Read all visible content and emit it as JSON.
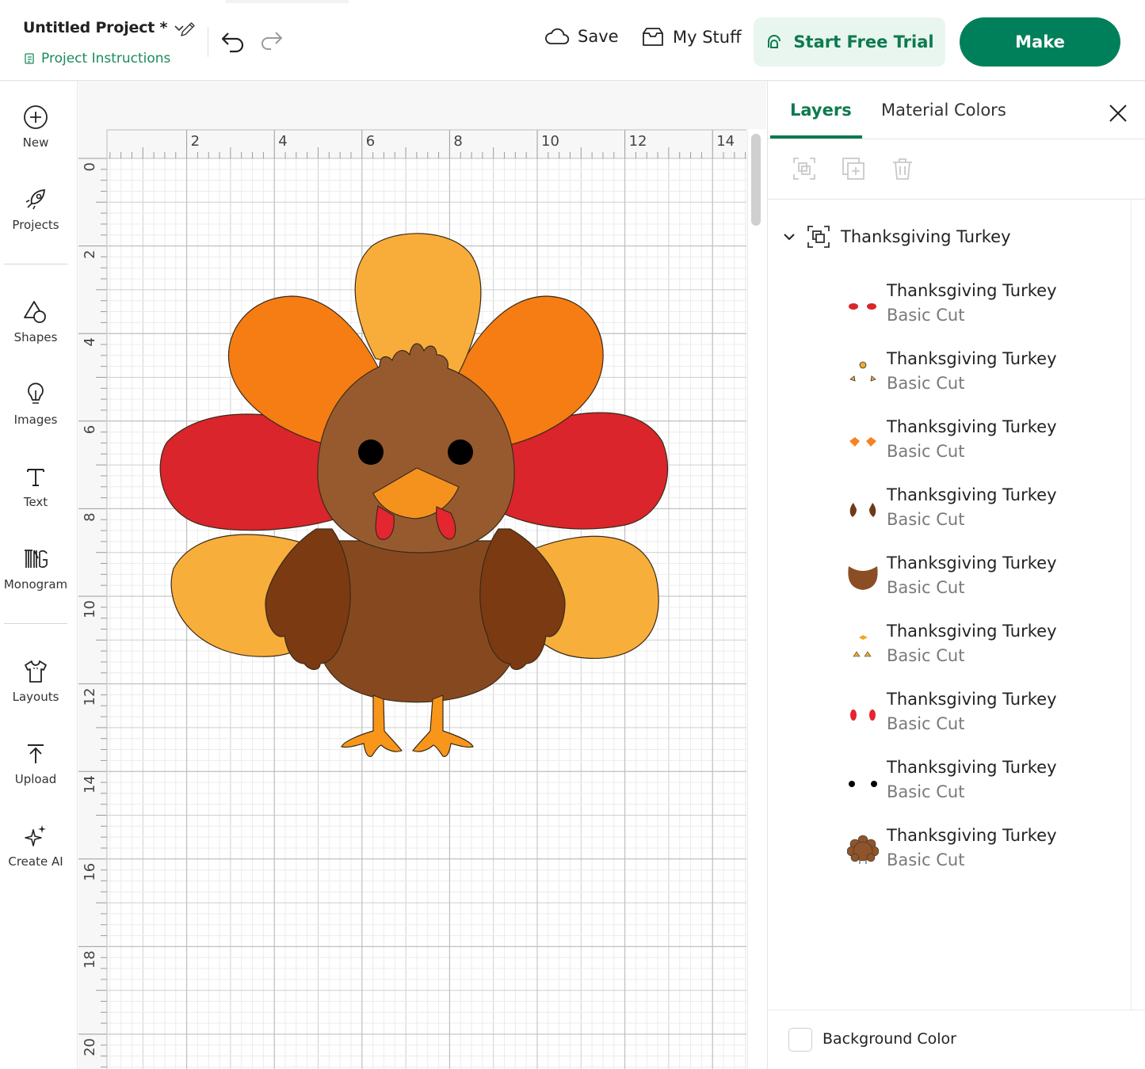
{
  "header": {
    "project_title": "Untitled Project *",
    "project_instructions": "Project Instructions",
    "save_label": "Save",
    "my_stuff_label": "My Stuff",
    "trial_label": "Start Free Trial",
    "make_label": "Make"
  },
  "toolbar": {
    "items": [
      {
        "label": "New",
        "icon": "plus-circle-icon"
      },
      {
        "label": "Projects",
        "icon": "rocket-icon"
      },
      {
        "label": "Shapes",
        "icon": "shapes-icon"
      },
      {
        "label": "Images",
        "icon": "lightbulb-icon"
      },
      {
        "label": "Text",
        "icon": "text-icon"
      },
      {
        "label": "Monogram",
        "icon": "monogram-icon"
      },
      {
        "label": "Layouts",
        "icon": "tshirt-icon"
      },
      {
        "label": "Upload",
        "icon": "upload-icon"
      },
      {
        "label": "Create AI",
        "icon": "sparkle-icon"
      }
    ]
  },
  "rulers": {
    "horizontal_labels": [
      "2",
      "4",
      "6",
      "8",
      "10",
      "12",
      "14"
    ],
    "vertical_labels": [
      "0",
      "2",
      "4",
      "6",
      "8",
      "10",
      "12",
      "14",
      "16",
      "18",
      "20"
    ]
  },
  "panel": {
    "tab_layers": "Layers",
    "tab_material_colors": "Material Colors",
    "group_name": "Thanksgiving Turkey",
    "layers": [
      {
        "name": "Thanksgiving Turkey",
        "type": "Basic Cut",
        "color": "#d9252b"
      },
      {
        "name": "Thanksgiving Turkey",
        "type": "Basic Cut",
        "color": "#f0a82e"
      },
      {
        "name": "Thanksgiving Turkey",
        "type": "Basic Cut",
        "color": "#f5831f"
      },
      {
        "name": "Thanksgiving Turkey",
        "type": "Basic Cut",
        "color": "#6e3a18"
      },
      {
        "name": "Thanksgiving Turkey",
        "type": "Basic Cut",
        "color": "#8b4e24"
      },
      {
        "name": "Thanksgiving Turkey",
        "type": "Basic Cut",
        "color": "#f5a623"
      },
      {
        "name": "Thanksgiving Turkey",
        "type": "Basic Cut",
        "color": "#e3262f"
      },
      {
        "name": "Thanksgiving Turkey",
        "type": "Basic Cut",
        "color": "#000000"
      },
      {
        "name": "Thanksgiving Turkey",
        "type": "Basic Cut",
        "color": "#8f542a"
      }
    ],
    "background_color_label": "Background Color"
  },
  "colors": {
    "accent": "#0e7a4f",
    "make_button": "#00805a",
    "trial_bg": "#e8f6ef"
  }
}
